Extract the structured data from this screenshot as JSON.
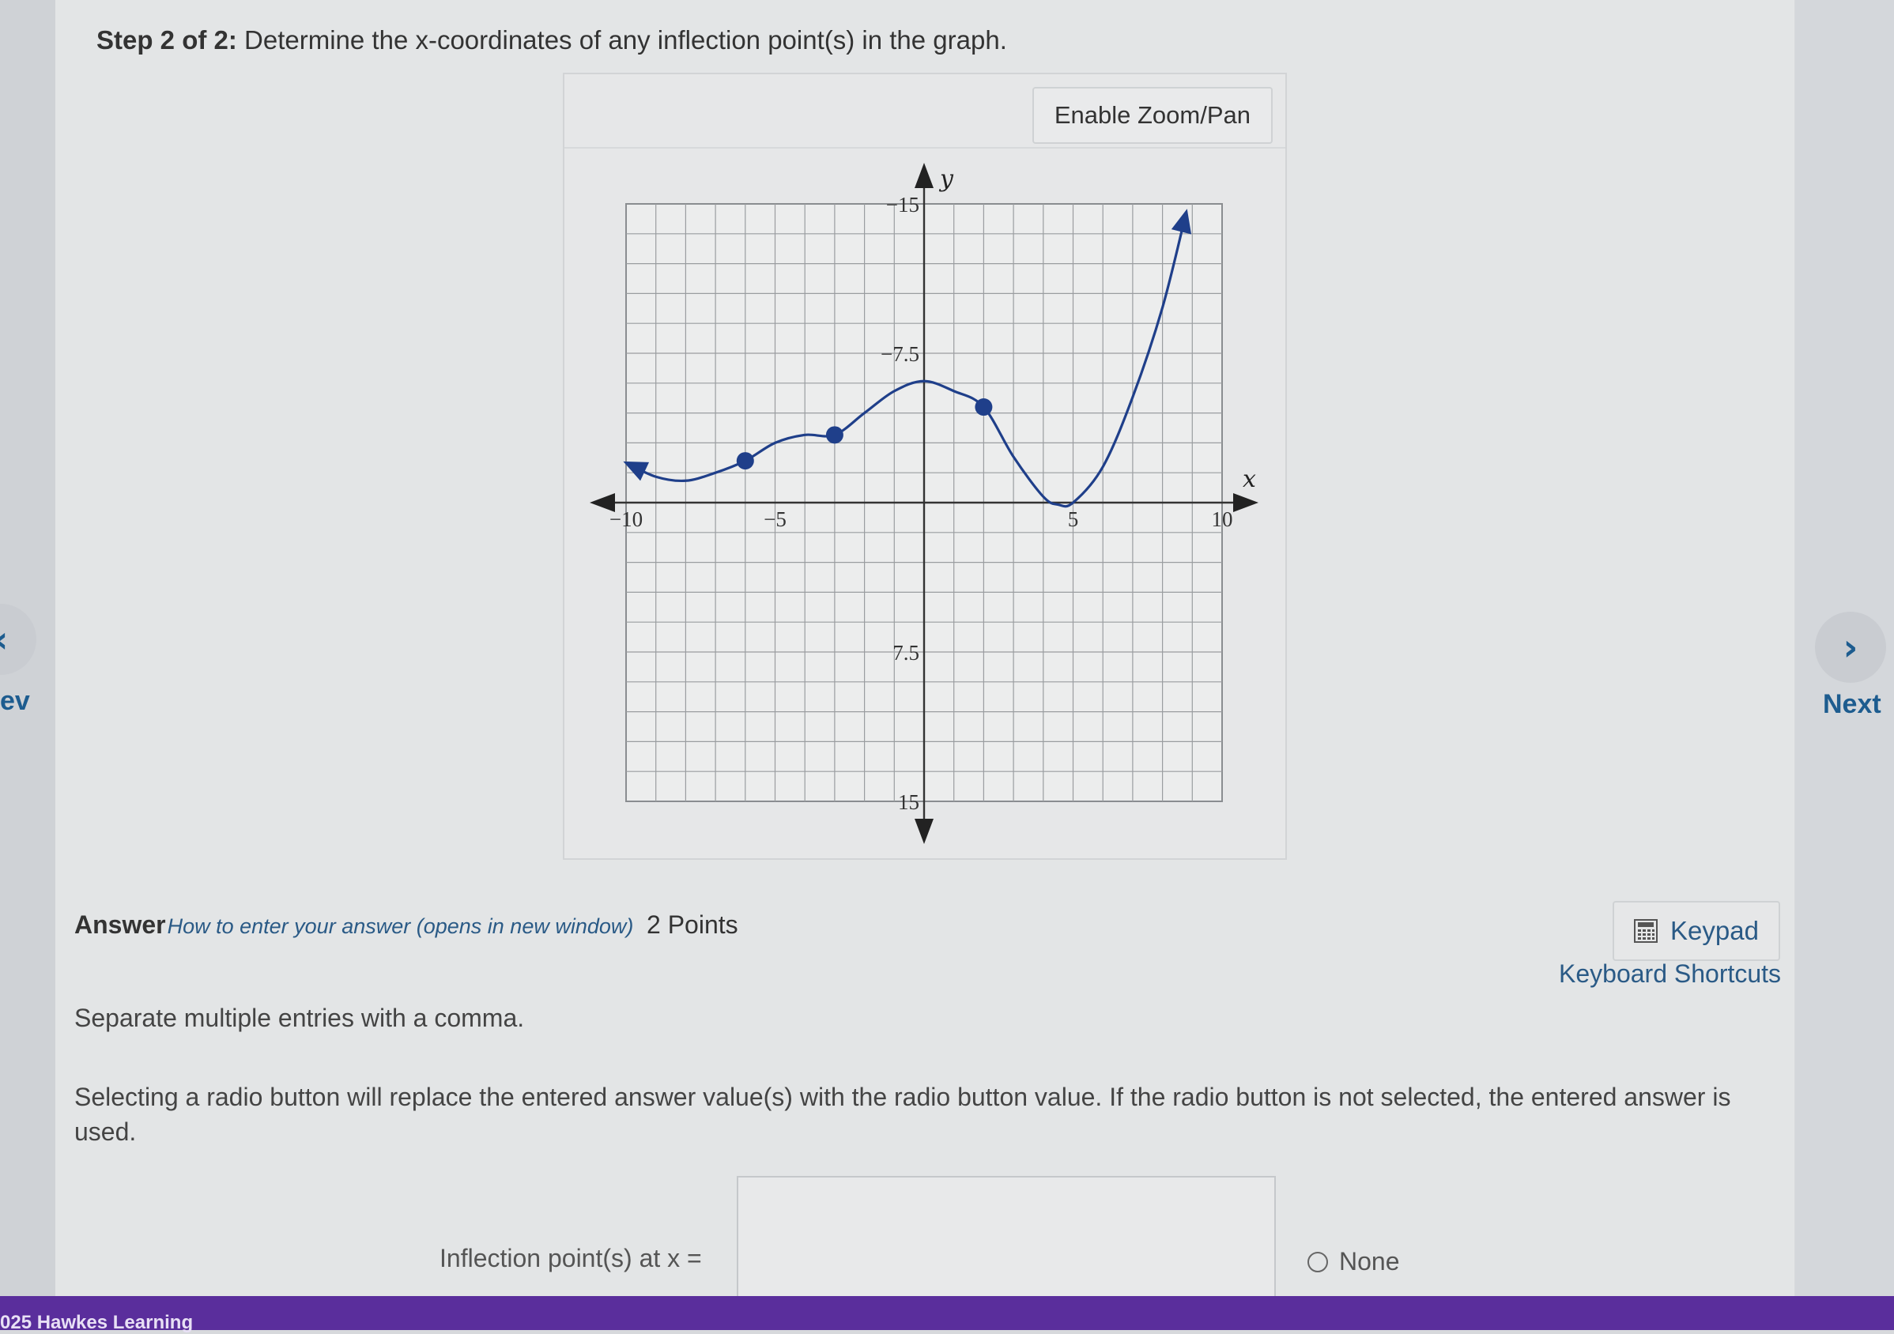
{
  "nav": {
    "prev_label": "ev",
    "next_label": "Next"
  },
  "question": {
    "step_prefix": "Step 2 of 2:",
    "prompt": "Determine the x-coordinates of any inflection point(s) in the graph."
  },
  "graph": {
    "zoom_button": "Enable Zoom/Pan",
    "x_axis_label": "x",
    "y_axis_label": "y",
    "x_tick_labels": [
      "−10",
      "−5",
      "5",
      "10"
    ],
    "y_tick_labels": [
      "15",
      "7.5",
      "−7.5",
      "−15"
    ]
  },
  "chart_data": {
    "type": "line",
    "xlim": [
      -10,
      10
    ],
    "ylim": [
      -15,
      15
    ],
    "grid": true,
    "x_ticks": [
      -10,
      -5,
      5,
      10
    ],
    "y_ticks": [
      -15,
      -7.5,
      7.5,
      15
    ],
    "curve": [
      [
        -10,
        2
      ],
      [
        -9,
        1.3
      ],
      [
        -8,
        1.1
      ],
      [
        -7,
        1.5
      ],
      [
        -6,
        2.1
      ],
      [
        -5,
        3.0
      ],
      [
        -4,
        3.4
      ],
      [
        -3,
        3.4
      ],
      [
        -2,
        4.5
      ],
      [
        -1,
        5.6
      ],
      [
        0,
        6.1
      ],
      [
        1,
        5.6
      ],
      [
        2,
        4.8
      ],
      [
        3,
        2.3
      ],
      [
        4,
        0.3
      ],
      [
        4.5,
        -0.1
      ],
      [
        5,
        0
      ],
      [
        6,
        1.8
      ],
      [
        7,
        5.3
      ],
      [
        8,
        9.8
      ],
      [
        8.8,
        14.6
      ]
    ],
    "marked_points": [
      [
        -6,
        2.1
      ],
      [
        -3,
        3.4
      ],
      [
        2,
        4.8
      ]
    ]
  },
  "answer": {
    "heading": "Answer",
    "help_link": "How to enter your answer (opens in new window)",
    "points": "2 Points",
    "keypad": "Keypad",
    "keyboard_shortcuts": "Keyboard Shortcuts",
    "instruction_1": "Separate multiple entries with a comma.",
    "instruction_2": "Selecting a radio button will replace the entered answer value(s) with the radio button value. If the radio button is not selected, the entered answer is used.",
    "input_label": "Inflection point(s) at x =",
    "input_value": "",
    "radio_none_label": "None"
  },
  "footer": {
    "text": "025 Hawkes Learning"
  },
  "colors": {
    "curve": "#1f3f8a",
    "link": "#2a5a86",
    "footer": "#5a2e9c"
  }
}
